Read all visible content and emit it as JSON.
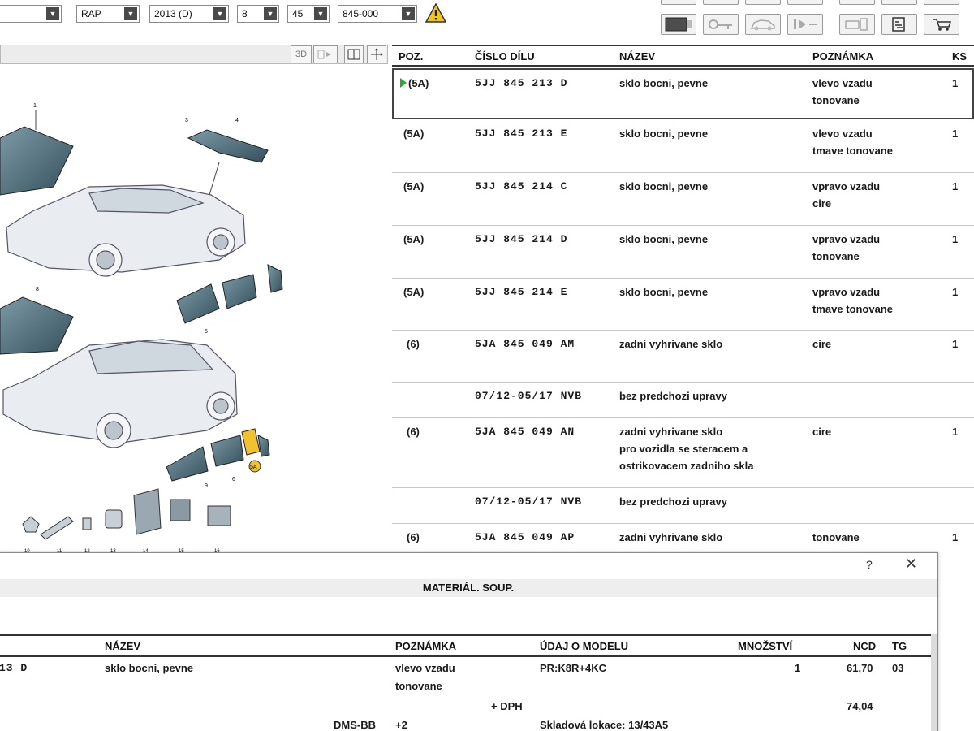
{
  "toolbar": {
    "combos": [
      {
        "value": ""
      },
      {
        "value": "RAP"
      },
      {
        "value": "2013 (D)"
      },
      {
        "value": "8"
      },
      {
        "value": "45"
      },
      {
        "value": "845-000"
      }
    ],
    "warning_icon": "warning-triangle-icon",
    "buttons": [
      "image-view-icon",
      "key-icon",
      "car-parts-icon",
      "play-step-icon",
      "part-preview-icon",
      "catalog-icon",
      "cart-icon"
    ]
  },
  "viewer": {
    "tools": [
      "3D",
      "",
      "",
      ""
    ]
  },
  "parts_table": {
    "columns": {
      "pos": "POZ.",
      "part": "ČÍSLO DÍLU",
      "name": "NÁZEV",
      "note": "POZNÁMKA",
      "qty": "KS"
    },
    "rows": [
      {
        "pos": "(5A)",
        "part": "5JJ 845 213 D",
        "name": "sklo bocni, pevne",
        "note": "vlevo vzadu\ntonovane",
        "qty": "1",
        "selected": true
      },
      {
        "pos": "(5A)",
        "part": "5JJ 845 213 E",
        "name": "sklo bocni, pevne",
        "note": "vlevo vzadu\ntmave tonovane",
        "qty": "1"
      },
      {
        "pos": "(5A)",
        "part": "5JJ 845 214 C",
        "name": "sklo bocni, pevne",
        "note": "vpravo vzadu\ncire",
        "qty": "1"
      },
      {
        "pos": "(5A)",
        "part": "5JJ 845 214 D",
        "name": "sklo bocni, pevne",
        "note": "vpravo vzadu\ntonovane",
        "qty": "1"
      },
      {
        "pos": "(5A)",
        "part": "5JJ 845 214 E",
        "name": "sklo bocni, pevne",
        "note": "vpravo vzadu\ntmave tonovane",
        "qty": "1"
      },
      {
        "pos": "(6)",
        "part": "5JA 845 049 AM",
        "name": "zadni vyhrivane sklo",
        "note": "cire",
        "qty": "1"
      },
      {
        "pos": "",
        "part": "07/12-05/17 NVB",
        "name": "bez predchozi upravy",
        "note": "",
        "qty": ""
      },
      {
        "pos": "(6)",
        "part": "5JA 845 049 AN",
        "name": "zadni vyhrivane sklo\npro vozidla se steracem a\nostrikovacem zadniho skla",
        "note": "cire",
        "qty": "1"
      },
      {
        "pos": "",
        "part": "07/12-05/17 NVB",
        "name": "bez predchozi upravy",
        "note": "",
        "qty": ""
      },
      {
        "pos": "(6)",
        "part": "5JA 845 049 AP",
        "name": "zadni vyhrivane sklo",
        "note": "tonovane",
        "qty": "1"
      }
    ]
  },
  "dialog": {
    "help": "?",
    "close": "✕",
    "title": "MATERIÁL. SOUP.",
    "columns": {
      "name": "NÁZEV",
      "note": "POZNÁMKA",
      "model": "ÚDAJ O MODELU",
      "qty": "MNOŽSTVÍ",
      "ncd": "NCD",
      "tg": "TG"
    },
    "row": {
      "part_tail": "13 D",
      "name": "sklo bocni, pevne",
      "note": "vlevo vzadu\ntonovane",
      "model": "PR:K8R+4KC",
      "qty": "1",
      "ncd": "61,70",
      "tg": "03",
      "vat_label": "+ DPH",
      "vat_price": "74,04",
      "dms": "DMS-BB",
      "dms_value": "+2",
      "location": "Skladová lokace: 13/43A5"
    }
  },
  "illustration": {
    "callouts": [
      "1",
      "3",
      "4",
      "5",
      "5A",
      "6",
      "8",
      "9",
      "10",
      "11",
      "12",
      "13",
      "14",
      "15",
      "16"
    ],
    "accent": "#f2c12e",
    "glass_color": "#5b7886"
  }
}
